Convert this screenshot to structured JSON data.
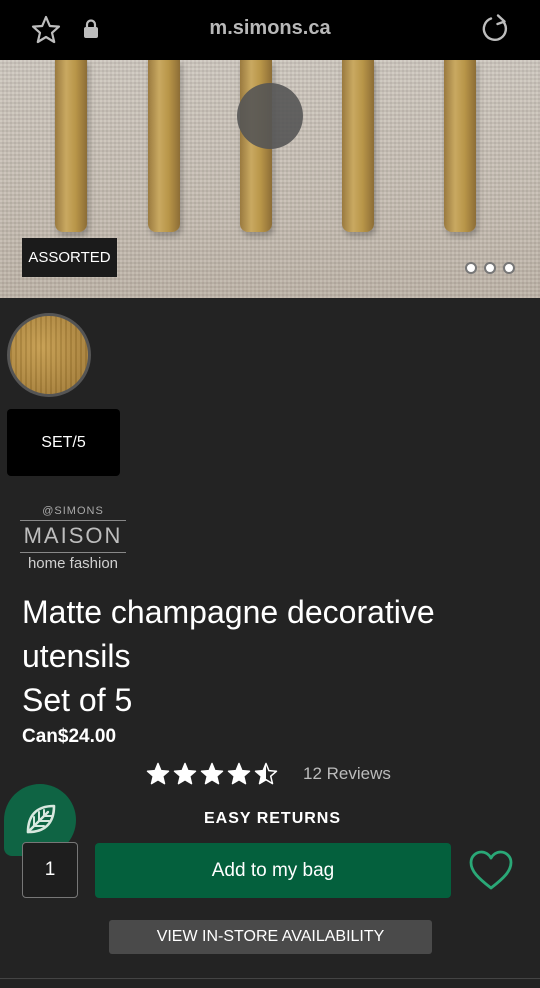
{
  "browser": {
    "url": "m.simons.ca"
  },
  "hero": {
    "badge": "ASSORTED",
    "carousel_dots": 3
  },
  "variant": {
    "size_label": "SET/5"
  },
  "brand": {
    "small": "@SIMONS",
    "main": "MAISON",
    "sub": "home fashion"
  },
  "product": {
    "title_line1": "Matte champagne decorative",
    "title_line2": "utensils",
    "title_line3": "Set of 5",
    "price": "Can$24.00",
    "rating": 4.5,
    "reviews_label": "12 Reviews"
  },
  "policy": {
    "easy_returns": "EASY RETURNS"
  },
  "cart": {
    "quantity": "1",
    "add_label": "Add to my bag"
  },
  "store": {
    "availability_label": "VIEW IN-STORE AVAILABILITY"
  },
  "colors": {
    "primary_green": "#04603d",
    "eco_green": "#0f6444",
    "background": "#232323"
  }
}
